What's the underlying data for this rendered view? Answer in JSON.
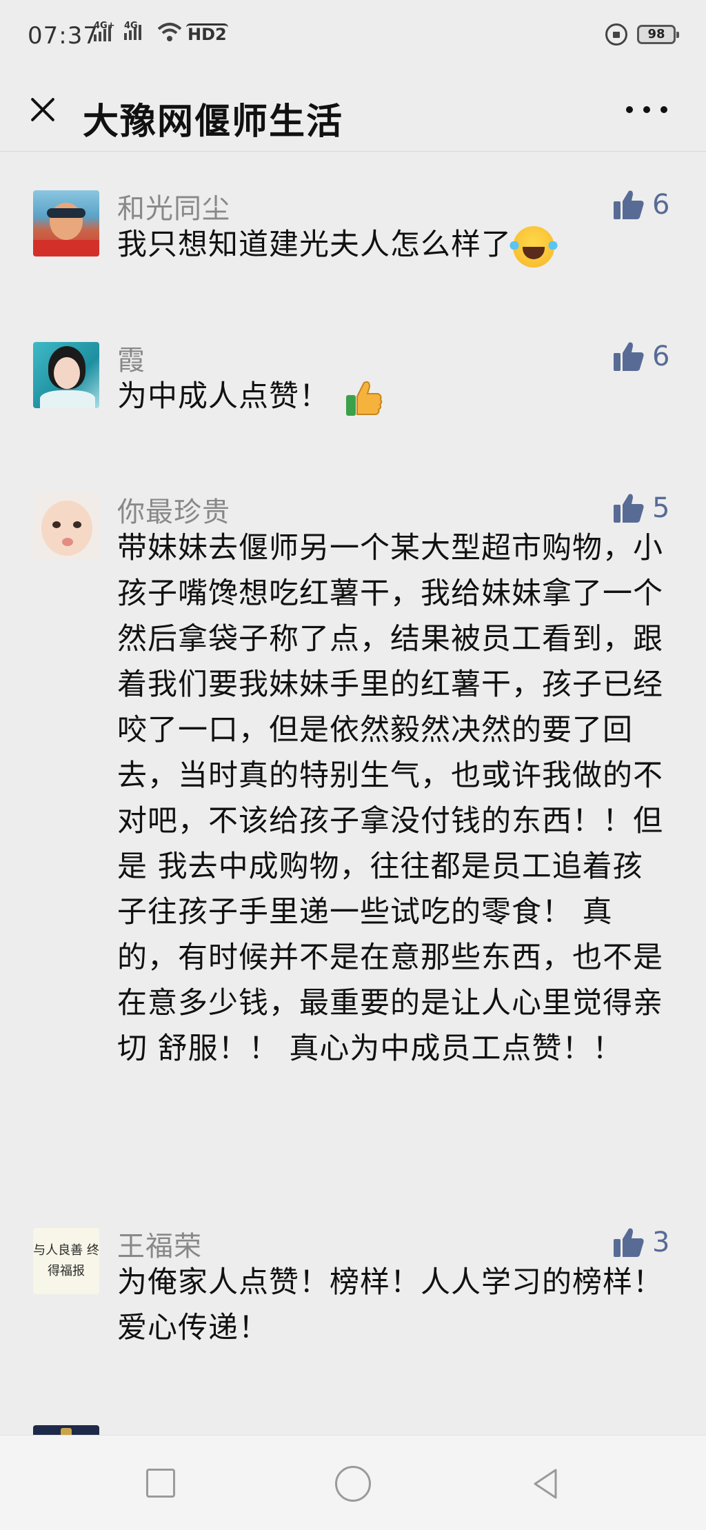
{
  "status_bar": {
    "time": "07:37",
    "signal_1_label": "4G+",
    "signal_2_label": "4G",
    "hd_label": "HD2",
    "battery": "98"
  },
  "nav": {
    "title": "大豫网偃师生活",
    "close_icon": "close-icon",
    "more_icon": "more-icon"
  },
  "colors": {
    "background": "#ededed",
    "like_blue": "#576b95",
    "username_gray": "#888888"
  },
  "comments": [
    {
      "username": "和光同尘",
      "likes": "6",
      "text": "我只想知道建光夫人怎么样了",
      "emoji": "tears-of-joy-emoji"
    },
    {
      "username": "霞",
      "likes": "6",
      "text": "为中成人点赞！",
      "emoji": "thumbs-up-emoji"
    },
    {
      "username": "你最珍贵",
      "likes": "5",
      "text": "带妹妹去偃师另一个某大型超市购物，小孩子嘴馋想吃红薯干，我给妹妹拿了一个然后拿袋子称了点，结果被员工看到，跟着我们要我妹妹手里的红薯干，孩子已经咬了一口，但是依然毅然决然的要了回去，当时真的特别生气，也或许我做的不对吧，不该给孩子拿没付钱的东西！！但是 我去中成购物，往往都是员工追着孩子往孩子手里递一些试吃的零食！ 真的，有时候并不是在意那些东西，也不是在意多少钱，最重要的是让人心里觉得亲切 舒服！！ 真心为中成员工点赞！！"
    },
    {
      "username": "王福荣",
      "likes": "3",
      "text": "为俺家人点赞！榜样！人人学习的榜样！爱心传递！",
      "avatar_text": "与人良善 终得福报"
    }
  ],
  "bottom_nav": [
    "recent-apps-button",
    "home-button",
    "back-button"
  ]
}
